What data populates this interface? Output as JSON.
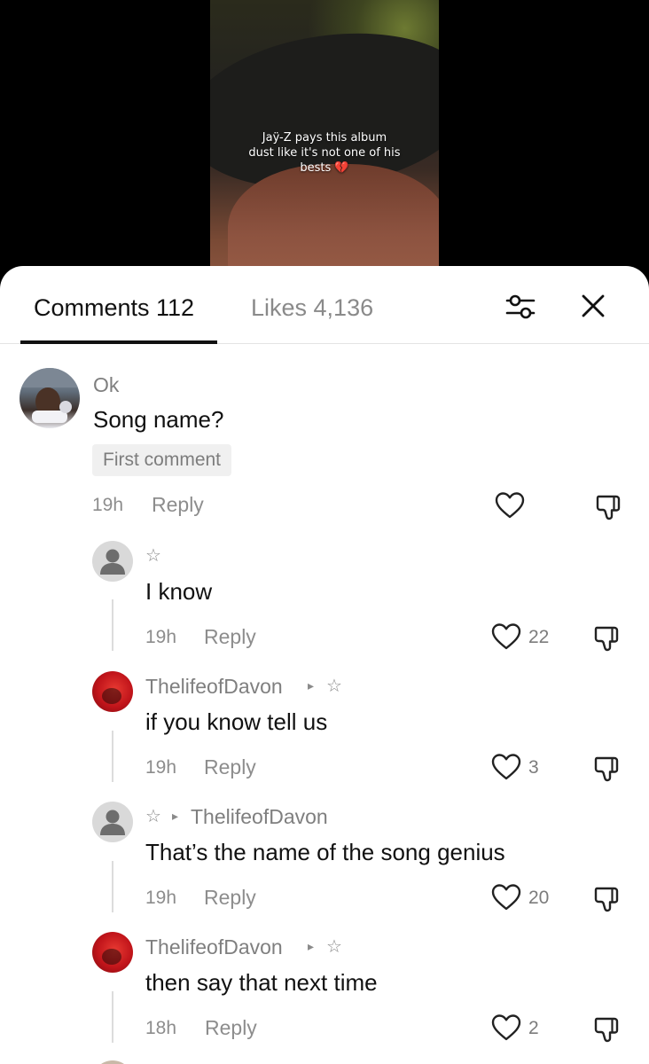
{
  "video": {
    "caption_lines": [
      "Jaÿ-Z pays this album",
      "dust like it's not one of his",
      "bests 💔"
    ]
  },
  "tabs": {
    "comments_label": "Comments 112",
    "likes_label": "Likes 4,136"
  },
  "icons": {
    "filter": "filter-sliders-icon",
    "close": "close-icon",
    "like": "heart-icon",
    "dislike": "thumbs-down-icon"
  },
  "comments": [
    {
      "username": "Ok",
      "text": "Song name?",
      "badge": "First comment",
      "time": "19h",
      "reply_label": "Reply",
      "likes": ""
    },
    {
      "username": "☆",
      "text": "I know",
      "time": "19h",
      "reply_label": "Reply",
      "likes": "22"
    },
    {
      "username": "ThelifeofDavon",
      "username_marker": "▸",
      "reply_to": "☆",
      "text": "if you know tell us",
      "time": "19h",
      "reply_label": "Reply",
      "likes": "3"
    },
    {
      "username": "☆",
      "username_marker": "▸",
      "reply_to": "ThelifeofDavon",
      "text": "That’s the name of the song genius",
      "time": "19h",
      "reply_label": "Reply",
      "likes": "20"
    },
    {
      "username": "ThelifeofDavon",
      "username_marker": "▸",
      "reply_to": "☆",
      "text": "then say that next time",
      "time": "18h",
      "reply_label": "Reply",
      "likes": "2"
    }
  ],
  "colors": {
    "text_primary": "#111111",
    "text_secondary": "#8d8d8d",
    "sheet_bg": "#ffffff",
    "badge_bg": "#f0f0f0",
    "avatar_red": "#c0141a"
  }
}
